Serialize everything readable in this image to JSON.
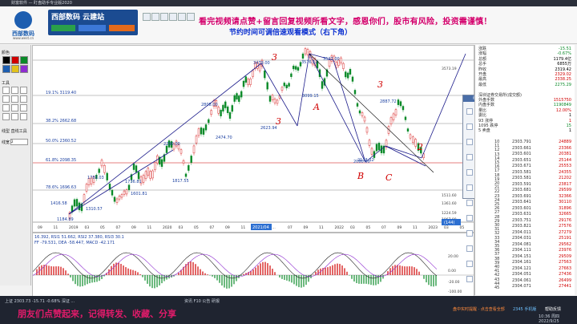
{
  "window": {
    "title": "财富软件 — 盯盘助手专业版2020"
  },
  "header": {
    "brand": "西部数码",
    "brand_url": "www.west.cn",
    "banner_title": "西部数码 云建站",
    "banner_sub": "建站从未如此简单",
    "headline": "看完视频请点赞+留言回复视频所看文字，感恩你们，股市有风险，投资需谨慎！",
    "subline": "节约时间可调倍速观看模式（右下角）"
  },
  "left_panel": {
    "color_label": "颜色",
    "tools_label": "工具",
    "line_label": "线型 直线工具",
    "width_label": "线宽",
    "width_value": "2"
  },
  "chart": {
    "fib_labels": [
      {
        "label": "19.1% 3119.40"
      },
      {
        "label": "38.2% 2662.68"
      },
      {
        "label": "50.0% 2360.52"
      },
      {
        "label": "61.8% 2098.35"
      },
      {
        "label": "78.6% 1696.63"
      }
    ],
    "price_labels": [
      "3479.00",
      "3576.12",
      "3527.00",
      "2887.72",
      "2808.00",
      "2623.94",
      "2474.70",
      "2290.00",
      "1817.55",
      "1783.03",
      "1736.81",
      "1601.81",
      "1416.58",
      "1310.57",
      "1184.89",
      "2133.32",
      "3099.15",
      "2080.00"
    ],
    "right_axis": [
      "3573.19",
      "1511.60",
      "1361.60",
      "1224.59",
      "1067.08"
    ],
    "xaxis": [
      "09",
      "11",
      "2019",
      "03",
      "05",
      "07",
      "09",
      "11",
      "2020",
      "03",
      "05",
      "07",
      "09",
      "11",
      "2021/04",
      "...",
      "07",
      "09",
      "11",
      "2022",
      "03",
      "05",
      "07",
      "09",
      "11",
      "2023",
      "03",
      "05"
    ],
    "date_box": "2021/04",
    "val_box": "(144)",
    "annotations": [
      "3",
      "3",
      "A",
      "3",
      "B",
      "C",
      "2"
    ]
  },
  "indicator": {
    "line1": "16.392, RSI1 51.662, RSI2 37.380, RSI3 30.1",
    "line2": "FF -79.531, DEA -58.447, MACD -42.171",
    "right_ticks": [
      "20.00",
      "0.00",
      "-20.00",
      "-100.00"
    ]
  },
  "right_panel": {
    "rows": [
      {
        "l": "涨跌",
        "v": "-15.51",
        "c": "green"
      },
      {
        "l": "涨幅",
        "v": "-0.67%",
        "c": "green"
      },
      {
        "l": "总额",
        "v": "1179.4亿",
        "c": ""
      },
      {
        "l": "总手",
        "v": "6855万",
        "c": ""
      },
      {
        "l": "昨收",
        "v": "2319.42",
        "c": ""
      },
      {
        "l": "开盘",
        "v": "2329.02",
        "c": "red"
      },
      {
        "l": "最高",
        "v": "2338.25",
        "c": "red"
      },
      {
        "l": "最低",
        "v": "2275.29",
        "c": "green"
      },
      {
        "l": "",
        "v": "",
        "c": ""
      },
      {
        "l": "深圳证券交易所(成交额)",
        "v": "",
        "c": ""
      },
      {
        "l": "外盘手数",
        "v": "1515750",
        "c": "red"
      },
      {
        "l": "内盘手数",
        "v": "1190849",
        "c": "green"
      },
      {
        "l": "量比",
        "v": "12.00%",
        "c": "red"
      },
      {
        "l": "委比",
        "v": "1",
        "c": ""
      },
      {
        "l": "93 涨停",
        "v": "1",
        "c": "red"
      },
      {
        "l": "1095 跌停",
        "v": "15",
        "c": "green"
      },
      {
        "l": "5 卖盘",
        "v": "1",
        "c": ""
      }
    ],
    "ticks": [
      {
        "p": "2303.791",
        "v": "24889"
      },
      {
        "p": "2303.661",
        "v": "23366"
      },
      {
        "p": "2303.601",
        "v": "20381"
      },
      {
        "p": "2303.651",
        "v": "25144"
      },
      {
        "p": "2303.671",
        "v": "25553"
      },
      {
        "p": "2303.581",
        "v": "24355"
      },
      {
        "p": "2303.581",
        "v": "21202"
      },
      {
        "p": "2303.591",
        "v": "23817"
      },
      {
        "p": "2303.681",
        "v": "29599"
      },
      {
        "p": "2303.691",
        "v": "32366"
      },
      {
        "p": "2303.641",
        "v": "30110"
      },
      {
        "p": "2303.601",
        "v": "31896"
      },
      {
        "p": "2303.631",
        "v": "32665"
      },
      {
        "p": "2303.751",
        "v": "29176"
      },
      {
        "p": "2303.821",
        "v": "27576"
      },
      {
        "p": "2304.011",
        "v": "27279"
      },
      {
        "p": "2304.031",
        "v": "25191"
      },
      {
        "p": "2304.081",
        "v": "29562"
      },
      {
        "p": "2304.111",
        "v": "23976"
      },
      {
        "p": "2304.151",
        "v": "29509"
      },
      {
        "p": "2304.161",
        "v": "27563"
      },
      {
        "p": "2304.121",
        "v": "27663"
      },
      {
        "p": "2304.051",
        "v": "27436"
      },
      {
        "p": "2304.061",
        "v": "26499"
      },
      {
        "p": "2304.071",
        "v": "27441"
      }
    ],
    "times": [
      "10",
      "11",
      "12",
      "13",
      "14",
      "15",
      "16",
      "17",
      "18",
      "19",
      "20",
      "21",
      "22",
      "23",
      "24",
      "25",
      "26",
      "27",
      "28",
      "29",
      "30",
      "31",
      "32",
      "33",
      "34",
      "35",
      "36",
      "37",
      "38",
      "39",
      "40",
      "41",
      "42",
      "43",
      "44",
      "45"
    ]
  },
  "draw_panel": {
    "title": "画线工具"
  },
  "status": {
    "left": "上证 2303.73 -15.71 -0.68%  深证 ...",
    "middle": "资讯 F10 公告 研报",
    "right1": "盘中实时提醒 · 点击查看全部",
    "right2": "2345 手机版",
    "right3": "帮助反馈",
    "clock": "10:36 周四",
    "date": "2022/9/25",
    "bottom_red": "朋友们点赞起来，记得转发、收藏、分享"
  }
}
